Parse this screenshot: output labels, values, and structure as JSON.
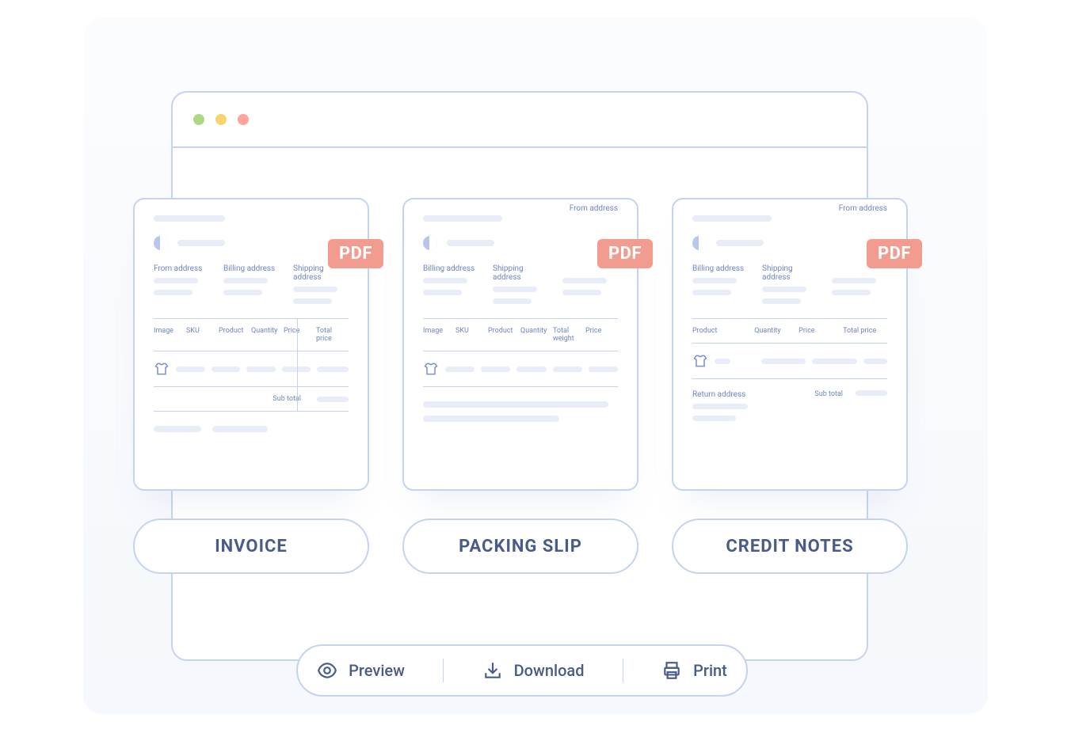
{
  "badge": "PDF",
  "labels": {
    "from_address": "From address",
    "billing_address": "Billing address",
    "shipping_address": "Shipping address",
    "return_address": "Return address",
    "sub_total": "Sub total"
  },
  "invoice": {
    "columns": [
      "Image",
      "SKU",
      "Product",
      "Quantity",
      "Price",
      "Total price"
    ]
  },
  "packing_slip": {
    "columns": [
      "Image",
      "SKU",
      "Product",
      "Quantity",
      "Total weight",
      "Price"
    ]
  },
  "credit_notes": {
    "columns": [
      "Product",
      "Quantity",
      "Price",
      "Total price"
    ]
  },
  "pills": {
    "invoice": "INVOICE",
    "packing_slip": "PACKING SLIP",
    "credit_notes": "CREDIT NOTES"
  },
  "actions": {
    "preview": "Preview",
    "download": "Download",
    "print": "Print"
  }
}
